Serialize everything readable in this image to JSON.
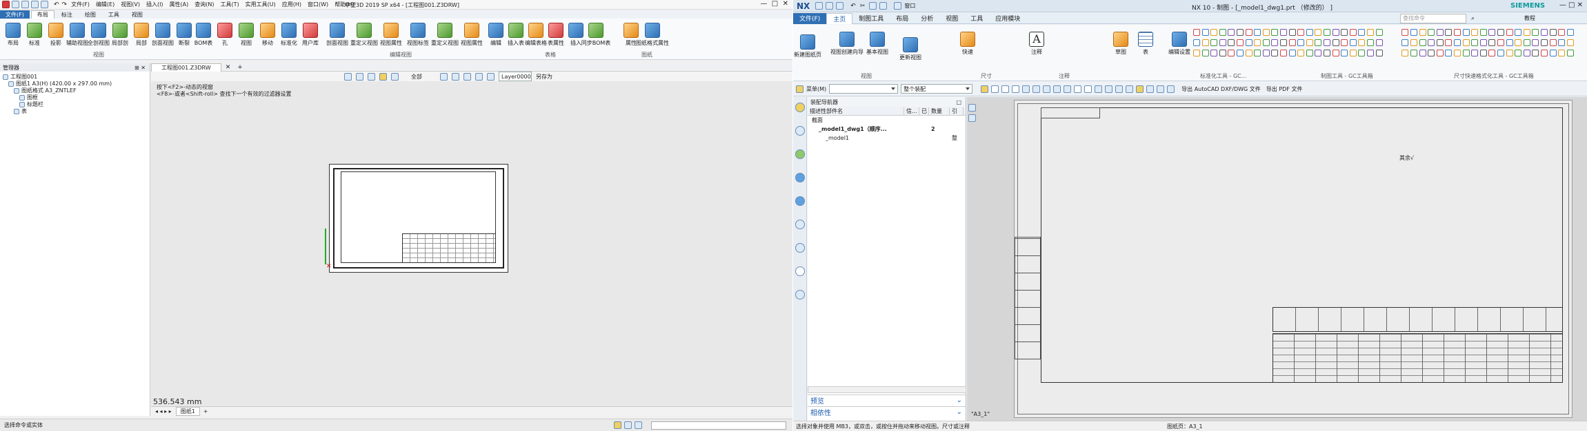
{
  "left": {
    "title": "中望3D 2019 SP x64 - [工程图001.Z3DRW]",
    "menu": [
      "文件(F)",
      "编辑(E)",
      "视图(V)",
      "插入(I)",
      "属性(A)",
      "查询(N)",
      "工具(T)",
      "实用工具(U)",
      "应用(H)",
      "窗口(W)",
      "帮助(H)"
    ],
    "tabs": [
      "文件(F)",
      "布局",
      "标注",
      "绘图",
      "工具",
      "视图"
    ],
    "ribbon": {
      "view_buttons": [
        "布局",
        "标准",
        "投影",
        "辅助视图",
        "全剖视图",
        "局部剖",
        "局部",
        "剖面视图",
        "断裂"
      ],
      "view_group": "视图",
      "edit_buttons": [
        "BOM表",
        "孔",
        "视图",
        "移动",
        "标准化",
        "用户库"
      ],
      "edit2_buttons": [
        "剖面视图",
        "重定义视图",
        "视图属性",
        "视图标签",
        "重定义视图",
        "视图属性"
      ],
      "edit_group": "编辑视图",
      "table_buttons": [
        "编辑",
        "插入表",
        "编辑表格",
        "表属性",
        "插入",
        "同步BOM表"
      ],
      "table_group": "表格",
      "sheet_buttons": [
        "属性",
        "图纸格式属性"
      ],
      "sheet_group": "图纸"
    },
    "manager_title": "管理器",
    "tree": [
      "工程图001",
      "图纸1 A3(H) (420.00 x 297.00 mm)",
      "图纸格式 A3_ZNTLEF",
      "图框",
      "标题栏",
      "表"
    ],
    "doc_tab": "工程图001.Z3DRW",
    "toolbar": {
      "all": "全部",
      "layer": "Layer0000",
      "saveas": "另存为"
    },
    "hint1": "按下<F2>-动态的视窗",
    "hint2": "<F8>-或者<Shift-roll> 查找下一个有效的过滤器设置",
    "measure": "536.543 mm",
    "sheet_tab": "图纸1",
    "status": "选择命令或实体"
  },
  "right": {
    "app": "NX",
    "title": "NX 10 - 制图 - [_model1_dwg1.prt （修改的） ]",
    "brand": "SIEMENS",
    "window_menu": "窗口",
    "tabs": [
      "文件(F)",
      "主页",
      "制图工具",
      "布局",
      "分析",
      "视图",
      "工具",
      "应用模块"
    ],
    "search_placeholder": "查找命令",
    "help": "教程",
    "ribbon": {
      "b1": "新建图纸页",
      "b2": "视图创建向导",
      "b3": "基本视图",
      "b4": "更新视图",
      "g_view": "视图",
      "b5": "快速",
      "g_dim": "尺寸",
      "b6": "注释",
      "g_ann": "注释",
      "b7": "草图",
      "b8": "表",
      "b9": "编辑设置",
      "g_std": "标准化工具 - GC...",
      "g_draw": "制图工具 - GC工具箱",
      "g_size": "尺寸快速格式化工具 - GC工具箱"
    },
    "filter": {
      "menu": "菜单(M)",
      "assembly": "整个装配"
    },
    "export1": "导出 AutoCAD DXF/DWG 文件",
    "export2": "导出 PDF 文件",
    "nav": {
      "title": "装配导航器",
      "cols": [
        "描述性部件名",
        "信...",
        "已",
        "数量",
        "引"
      ],
      "rows": [
        {
          "name": "截面",
          "qty": "",
          "ref": ""
        },
        {
          "name": "_model1_dwg1（顺序...",
          "qty": "2",
          "ref": ""
        },
        {
          "name": "_model1",
          "qty": "",
          "ref": "整"
        }
      ],
      "preview": "预览",
      "dependency": "相依性"
    },
    "sheet_label": "\"A3_1\"",
    "status_left": "选择对象并使用 MB3，或双击，或按住并拖动来移动视图。尺寸或注释",
    "status_right": "图纸页：A3_1"
  }
}
